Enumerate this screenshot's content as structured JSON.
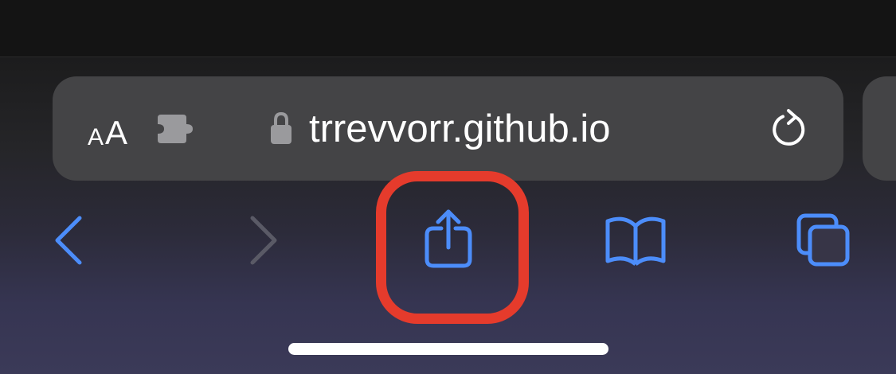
{
  "colors": {
    "accent": "#4c8dfa",
    "highlight": "#e53b2c",
    "address_bar": "#444446",
    "disabled": "#5a5a66"
  },
  "address_bar": {
    "text_size_label_small": "A",
    "text_size_label_large": "A",
    "url": "trrevvorr.github.io",
    "icons": {
      "extension": "puzzle-piece-icon",
      "secure": "lock-icon",
      "reload": "reload-icon"
    }
  },
  "toolbar": {
    "back": {
      "icon": "chevron-left-icon",
      "enabled": true
    },
    "forward": {
      "icon": "chevron-right-icon",
      "enabled": false
    },
    "share": {
      "icon": "share-icon",
      "highlighted": true
    },
    "bookmarks": {
      "icon": "book-icon"
    },
    "tabs": {
      "icon": "tabs-icon"
    }
  }
}
